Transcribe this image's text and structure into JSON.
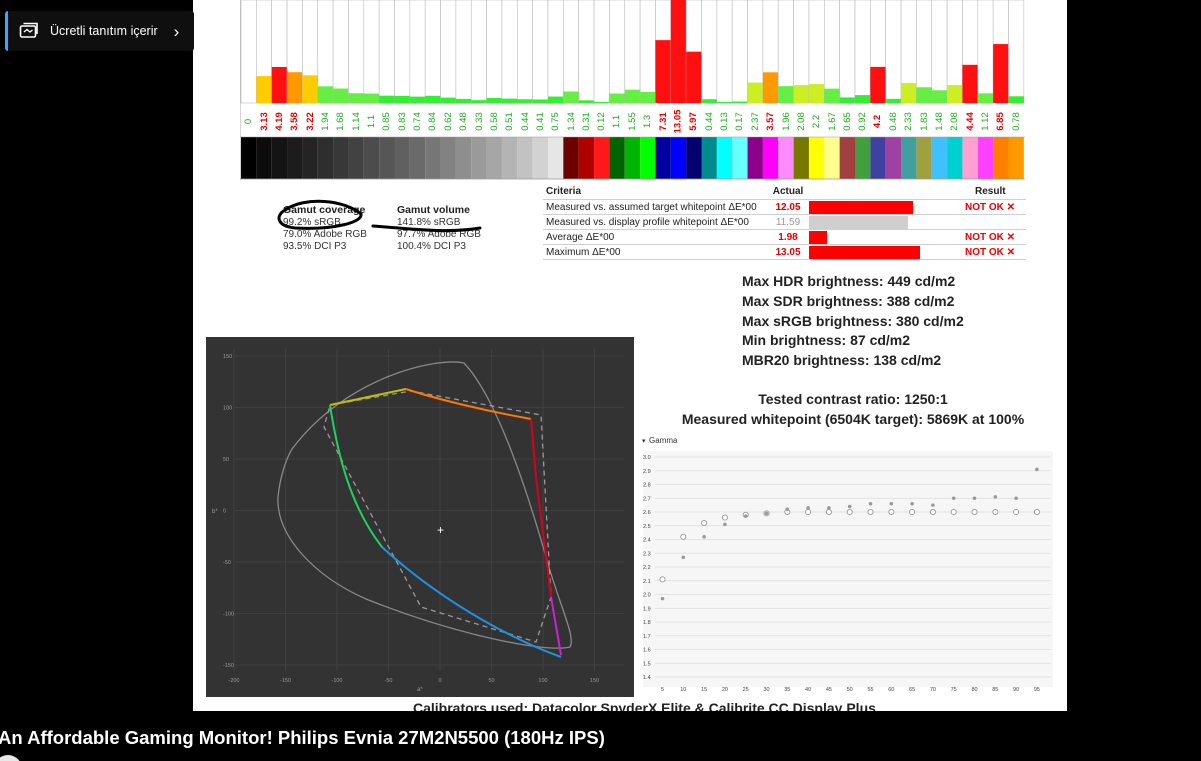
{
  "promo": {
    "label": "Ücretli tanıtım içerir",
    "icon": "paid-promotion-icon",
    "chevron": "›"
  },
  "video": {
    "title": "An Affordable Gaming Monitor! Philips Evnia 27M2N5500 (180Hz IPS)"
  },
  "delta_e": {
    "values": [
      "0",
      "3.13",
      "4.19",
      "3.58",
      "3.22",
      "1.94",
      "1.68",
      "1.14",
      "1.1",
      "0.85",
      "0.83",
      "0.74",
      "0.84",
      "0.62",
      "0.48",
      "0.33",
      "0.58",
      "0.51",
      "0.44",
      "0.41",
      "0.75",
      "1.34",
      "0.31",
      "0.12",
      "1.1",
      "1.55",
      "1.3",
      "7.31",
      "13.05",
      "5.97",
      "0.44",
      "0.13",
      "0.17",
      "2.37",
      "3.57",
      "1.96",
      "2.08",
      "2.2",
      "1.67",
      "0.65",
      "0.92",
      "4.2",
      "0.48",
      "2.33",
      "1.83",
      "1.48",
      "2.08",
      "4.44",
      "1.12",
      "6.85",
      "0.78"
    ],
    "patches": [
      "#000000",
      "#0c0c0c",
      "#141414",
      "#1c1c1c",
      "#242424",
      "#2e2e2e",
      "#383838",
      "#424242",
      "#4c4c4c",
      "#565656",
      "#606060",
      "#6a6a6a",
      "#767676",
      "#828282",
      "#8e8e8e",
      "#9a9a9a",
      "#a6a6a6",
      "#b4b4b4",
      "#c2c2c2",
      "#d2d2d2",
      "#e6e6e6",
      "#6e0000",
      "#b00000",
      "#ff1a1a",
      "#006400",
      "#00b400",
      "#00ff00",
      "#0000a0",
      "#0000ff",
      "#00006e",
      "#008c8c",
      "#00ffff",
      "#66ffff",
      "#8c008c",
      "#ff00ff",
      "#ff8cff",
      "#787800",
      "#ffff00",
      "#ffff8c",
      "#a04040",
      "#40a040",
      "#4040a0",
      "#a040a0",
      "#40a0a0",
      "#a0a040",
      "#40c0ff",
      "#00d0d0",
      "#ffa0d0",
      "#ff40ff",
      "#ff8000",
      "#ff9900"
    ]
  },
  "criteria": {
    "headers": {
      "name": "Criteria",
      "actual": "Actual",
      "result": "Result"
    },
    "rows": [
      {
        "name": "Measured vs. assumed target whitepoint ΔE*00",
        "actual": "12.05",
        "result": "NOT OK ✕",
        "bar": 0.69,
        "bar_color": "#ff0000",
        "actual_color": "#e00000"
      },
      {
        "name": "Measured vs. display profile whitepoint ΔE*00",
        "actual": "11.59",
        "result": "",
        "bar": 0.66,
        "bar_color": "#cfcfcf",
        "actual_color": "#999999"
      },
      {
        "name": "Average ΔE*00",
        "actual": "1.98",
        "result": "NOT OK ✕",
        "bar": 0.12,
        "bar_color": "#ff0000",
        "actual_color": "#e00000"
      },
      {
        "name": "Maximum ΔE*00",
        "actual": "13.05",
        "result": "NOT OK ✕",
        "bar": 0.74,
        "bar_color": "#ff0000",
        "actual_color": "#e00000"
      }
    ]
  },
  "gamut": {
    "coverage_title": "Gamut coverage",
    "coverage": [
      "99.2% sRGB",
      "79.0% Adobe RGB",
      "93.5% DCI P3"
    ],
    "volume_title": "Gamut volume",
    "volume": [
      "141.8% sRGB",
      "97.7% Adobe RGB",
      "100.4% DCI P3"
    ]
  },
  "brightness": {
    "max_hdr": "Max HDR brightness: 449 cd/m2",
    "max_sdr": "Max SDR brightness: 388 cd/m2",
    "max_srgb": "Max sRGB brightness: 380 cd/m2",
    "min": "Min brightness: 87 cd/m2",
    "mbr20": "MBR20 brightness: 138 cd/m2",
    "contrast": "Tested contrast ratio: 1250:1",
    "whitepoint": "Measured whitepoint (6504K target): 5869K at 100%"
  },
  "cie_plot": {
    "x_ticks": [
      "-200",
      "-150",
      "-100",
      "-50",
      "0",
      "50",
      "100",
      "150"
    ],
    "y_ticks": [
      "150",
      "100",
      "50",
      "0",
      "-50",
      "-100",
      "-150"
    ],
    "x_axis_label": "a*",
    "y_axis_label": "b*"
  },
  "chart_data": {
    "type": "scatter",
    "title": "Gamma",
    "x": [
      5,
      10,
      15,
      20,
      25,
      30,
      35,
      40,
      45,
      50,
      55,
      60,
      65,
      70,
      75,
      80,
      85,
      90,
      95
    ],
    "series": [
      {
        "values": [
          1.97,
          2.27,
          2.42,
          2.51,
          2.57,
          2.59,
          2.62,
          2.63,
          2.63,
          2.64,
          2.66,
          2.66,
          2.66,
          2.65,
          2.7,
          2.7,
          2.71,
          2.7,
          2.91
        ]
      },
      {
        "values": [
          2.11,
          2.42,
          2.52,
          2.56,
          2.58,
          2.59,
          2.6,
          2.6,
          2.6,
          2.6,
          2.6,
          2.6,
          2.6,
          2.6,
          2.6,
          2.6,
          2.6,
          2.6,
          2.6
        ]
      }
    ],
    "x_ticks": [
      "5",
      "10",
      "15",
      "20",
      "25",
      "30",
      "35",
      "40",
      "45",
      "50",
      "55",
      "60",
      "65",
      "70",
      "75",
      "80",
      "85",
      "90",
      "95"
    ],
    "y_ticks": [
      "1.4",
      "1.5",
      "1.6",
      "1.7",
      "1.8",
      "1.9",
      "2.0",
      "2.1",
      "2.2",
      "2.3",
      "2.4",
      "2.5",
      "2.6",
      "2.7",
      "2.8",
      "2.9",
      "3.0"
    ],
    "ylim": [
      1.4,
      3.0
    ],
    "grid": true
  },
  "calibrators": "Calibrators used: Datacolor SpyderX Elite & Calibrite CC Display Plus"
}
